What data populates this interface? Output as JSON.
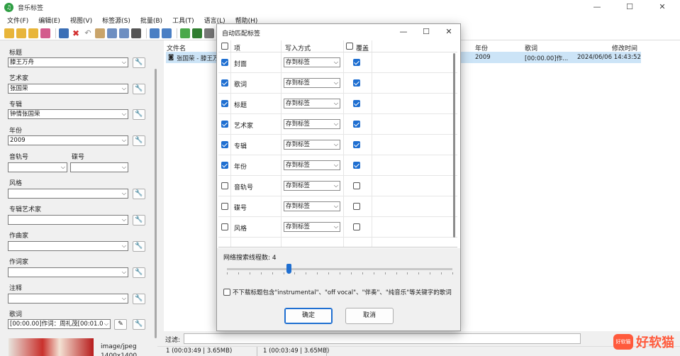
{
  "window": {
    "title": "音乐标签",
    "minimize": "—",
    "maximize": "☐",
    "close": "✕"
  },
  "menu": [
    "文件(F)",
    "编辑(E)",
    "视图(V)",
    "标签源(S)",
    "批量(B)",
    "工具(T)",
    "语言(L)",
    "帮助(H)"
  ],
  "left": {
    "fields": [
      {
        "label": "标题",
        "value": "滕王万舟"
      },
      {
        "label": "艺术家",
        "value": "张国荣"
      },
      {
        "label": "专辑",
        "value": "钟情张国荣"
      },
      {
        "label": "年份",
        "value": "2009"
      }
    ],
    "track_label": "音轨号",
    "disc_label": "碟号",
    "genre_label": "风格",
    "album_artist_label": "专辑艺术家",
    "composer_label": "作曲家",
    "lyricist_label": "作词家",
    "comment_label": "注释",
    "lyrics_label": "歌词",
    "lyrics_value": "[00:00.00]作词：周礼茂[00:01.0",
    "cover_type": "image/jpeg",
    "cover_size": "1400x1400"
  },
  "filelist": {
    "headers": {
      "filename": "文件名",
      "year": "年份",
      "lyrics": "歌词",
      "modified": "修改时间"
    },
    "row": {
      "filename": "张国荣 - 滕王万舟",
      "year": "2009",
      "lyrics": "[00:00.00]作...",
      "modified": "2024/06/06 14:43:52"
    }
  },
  "filter_label": "过滤:",
  "status": {
    "left": "1 (00:03:49 | 3.65MB)",
    "right": "1 (00:03:49 | 3.65MB)"
  },
  "dialog": {
    "title": "自动匹配标签",
    "headers": {
      "item": "项",
      "write": "写入方式",
      "overwrite": "覆盖"
    },
    "rows": [
      {
        "name": "封面",
        "checked": true,
        "write": "存到标签",
        "overwrite": true
      },
      {
        "name": "歌词",
        "checked": true,
        "write": "存到标签",
        "overwrite": true
      },
      {
        "name": "标题",
        "checked": true,
        "write": "存到标签",
        "overwrite": true
      },
      {
        "name": "艺术家",
        "checked": true,
        "write": "存到标签",
        "overwrite": true
      },
      {
        "name": "专辑",
        "checked": true,
        "write": "存到标签",
        "overwrite": true
      },
      {
        "name": "年份",
        "checked": true,
        "write": "存到标签",
        "overwrite": true
      },
      {
        "name": "音轨号",
        "checked": false,
        "write": "存到标签",
        "overwrite": false
      },
      {
        "name": "碟号",
        "checked": false,
        "write": "存到标签",
        "overwrite": false
      },
      {
        "name": "风格",
        "checked": false,
        "write": "存到标签",
        "overwrite": false
      }
    ],
    "threads_label": "网络搜索线程数: 4",
    "threads_value": 4,
    "option_text": "不下载标题包含\"instrumental\"、\"off vocal\"、\"伴奏\"、\"纯音乐\"等关键字的歌词",
    "ok": "确定",
    "cancel": "取消"
  },
  "watermark": {
    "logo": "好软猫",
    "text": "好软猫"
  }
}
